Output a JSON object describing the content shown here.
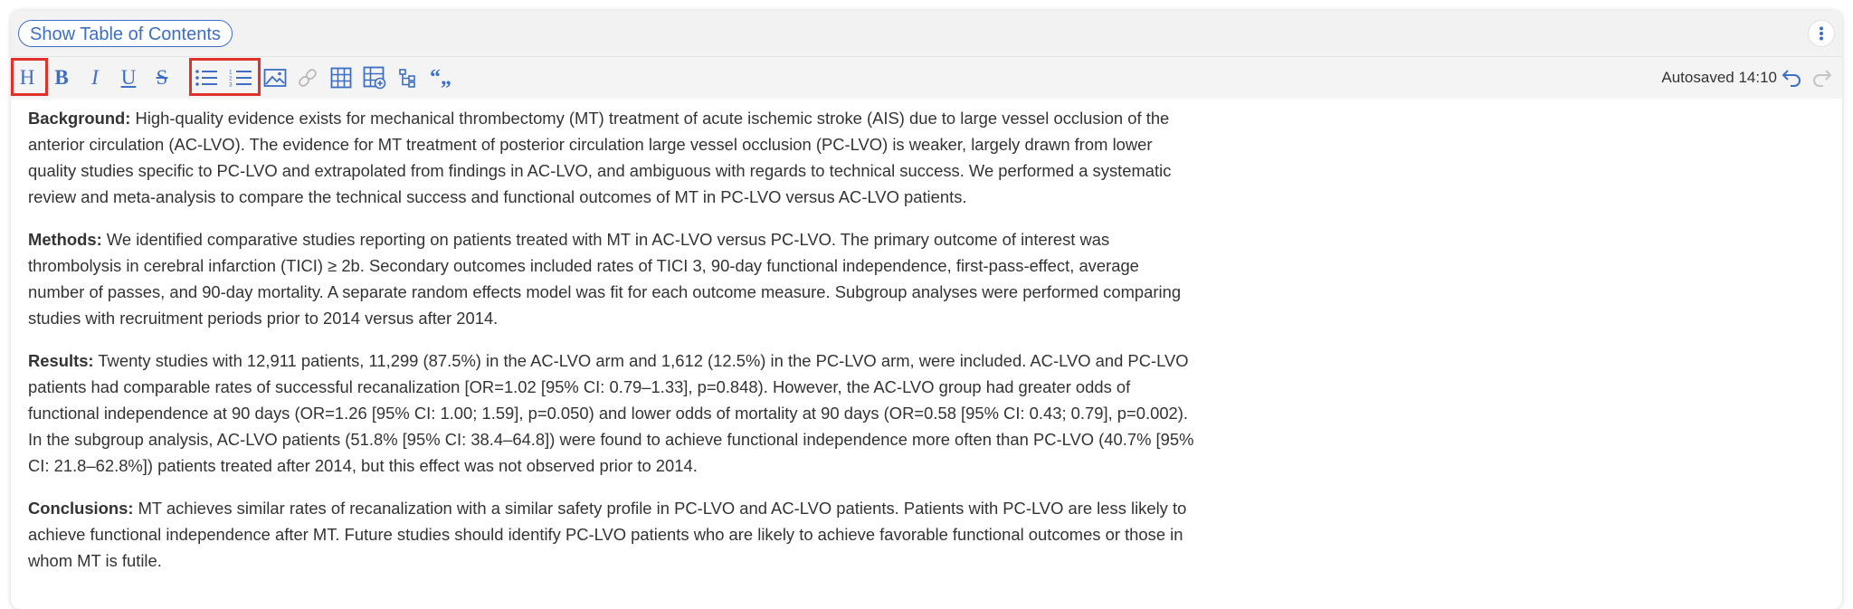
{
  "header": {
    "toc_button_label": "Show Table of Contents"
  },
  "toolbar": {
    "buttons": [
      {
        "name": "heading",
        "glyph": "H"
      },
      {
        "name": "bold",
        "glyph": "B"
      },
      {
        "name": "italic",
        "glyph": "I"
      },
      {
        "name": "underline",
        "glyph": "U"
      },
      {
        "name": "strikethrough",
        "glyph": "S"
      },
      {
        "name": "bullet-list",
        "icon": "bullet-list-icon"
      },
      {
        "name": "numbered-list",
        "icon": "numbered-list-icon"
      },
      {
        "name": "image",
        "icon": "image-icon"
      },
      {
        "name": "link",
        "icon": "link-icon"
      },
      {
        "name": "table",
        "icon": "table-icon"
      },
      {
        "name": "insert-table",
        "icon": "table-add-icon"
      },
      {
        "name": "tree",
        "icon": "tree-icon"
      },
      {
        "name": "quote",
        "glyph": "“„"
      }
    ],
    "autosave_text": "Autosaved 14:10",
    "accent_color": "#3d6ec5",
    "highlight_color": "#e0312b"
  },
  "abstract": {
    "background": {
      "label": "Background:",
      "text": " High-quality evidence exists for mechanical thrombectomy (MT) treatment of acute ischemic stroke (AIS) due to large vessel occlusion of the anterior circulation (AC-LVO). The evidence for MT treatment of posterior circulation large vessel occlusion (PC-LVO) is weaker, largely drawn from lower quality studies specific to PC-LVO and extrapolated from findings in AC-LVO, and ambiguous with regards to technical success. We performed a systematic review and meta-analysis to compare the technical success and functional outcomes of MT in PC-LVO versus AC-LVO patients."
    },
    "methods": {
      "label": "Methods:",
      "text": " We identified comparative studies reporting on patients treated with MT in AC-LVO versus PC-LVO. The primary outcome of interest was thrombolysis in cerebral infarction (TICI) ≥ 2b. Secondary outcomes included rates of TICI 3, 90-day functional independence, first-pass-effect, average number of passes, and 90-day mortality. A separate random effects model was fit for each outcome measure. Subgroup analyses were performed comparing studies with recruitment periods prior to 2014 versus after 2014."
    },
    "results": {
      "label": "Results:",
      "text": " Twenty studies with 12,911 patients, 11,299 (87.5%) in the AC-LVO arm and 1,612 (12.5%) in the PC-LVO arm, were included. AC-LVO and PC-LVO patients had comparable rates of successful recanalization [OR=1.02 [95% CI: 0.79–1.33], p=0.848). However, the AC-LVO group had greater odds of functional independence at 90 days (OR=1.26 [95% CI: 1.00; 1.59], p=0.050) and lower odds of mortality at 90 days (OR=0.58 [95% CI: 0.43; 0.79], p=0.002). In the subgroup analysis, AC-LVO patients (51.8% [95% CI: 38.4–64.8]) were found to achieve functional independence more often than PC-LVO (40.7% [95% CI: 21.8–62.8%]) patients treated after 2014, but this effect was not observed prior to 2014."
    },
    "conclusions": {
      "label": "Conclusions:",
      "text": " MT achieves similar rates of recanalization with a similar safety profile in PC-LVO and AC-LVO patients. Patients with PC-LVO are less likely to achieve functional independence after MT. Future studies should identify PC-LVO patients who are likely to achieve favorable functional outcomes or those in whom MT is futile."
    }
  }
}
